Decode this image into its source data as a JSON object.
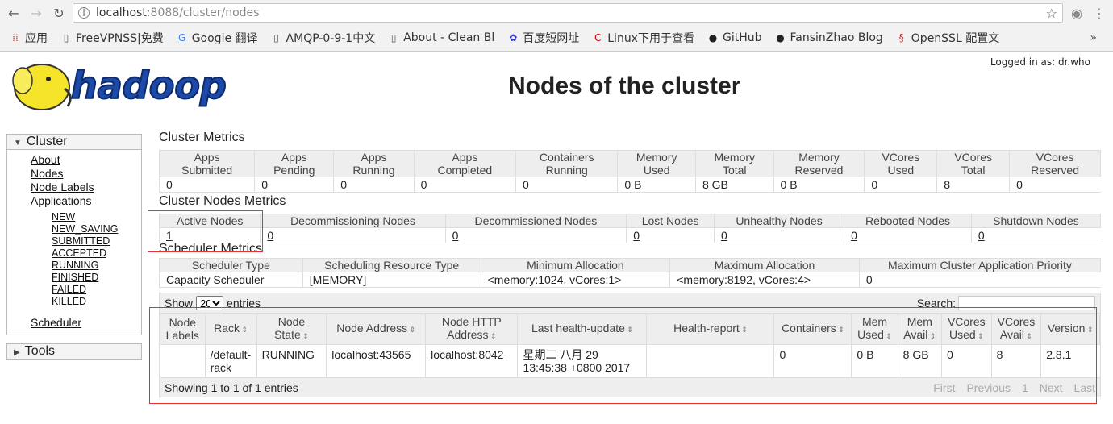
{
  "browser": {
    "url_host": "localhost",
    "url_rest": ":8088/cluster/nodes",
    "bookmarks": [
      {
        "label": "应用",
        "icon": "apps-grid-icon",
        "color": "#d33"
      },
      {
        "label": "FreeVPNSS|免费",
        "icon": "page-icon",
        "color": "#555"
      },
      {
        "label": "Google 翻译",
        "icon": "translate-icon",
        "color": "#4285f4"
      },
      {
        "label": "AMQP-0-9-1中文",
        "icon": "page-icon",
        "color": "#555"
      },
      {
        "label": "About - Clean Bl",
        "icon": "page-icon",
        "color": "#555"
      },
      {
        "label": "百度短网址",
        "icon": "baidu-paw-icon",
        "color": "#2932e1"
      },
      {
        "label": "Linux下用于查看",
        "icon": "c-logo-icon",
        "color": "#c00"
      },
      {
        "label": "GitHub",
        "icon": "github-icon",
        "color": "#222"
      },
      {
        "label": "FansinZhao Blog",
        "icon": "github-icon",
        "color": "#222"
      },
      {
        "label": "OpenSSL 配置文",
        "icon": "openssl-icon",
        "color": "#c22"
      }
    ],
    "more": "»"
  },
  "header": {
    "login": "Logged in as: dr.who",
    "title": "Nodes of the cluster"
  },
  "sidebar": {
    "cluster_label": "Cluster",
    "links": [
      "About",
      "Nodes",
      "Node Labels",
      "Applications"
    ],
    "app_states": [
      "NEW",
      "NEW_SAVING",
      "SUBMITTED",
      "ACCEPTED",
      "RUNNING",
      "FINISHED",
      "FAILED",
      "KILLED"
    ],
    "scheduler": "Scheduler",
    "tools_label": "Tools"
  },
  "cluster_metrics": {
    "title": "Cluster Metrics",
    "headers": [
      [
        "Apps",
        "Submitted"
      ],
      [
        "Apps",
        "Pending"
      ],
      [
        "Apps",
        "Running"
      ],
      [
        "Apps",
        "Completed"
      ],
      [
        "Containers",
        "Running"
      ],
      [
        "Memory",
        "Used"
      ],
      [
        "Memory",
        "Total"
      ],
      [
        "Memory",
        "Reserved"
      ],
      [
        "VCores",
        "Used"
      ],
      [
        "VCores",
        "Total"
      ],
      [
        "VCores",
        "Reserved"
      ]
    ],
    "values": [
      "0",
      "0",
      "0",
      "0",
      "0",
      "0 B",
      "8 GB",
      "0 B",
      "0",
      "8",
      "0"
    ]
  },
  "nodes_metrics": {
    "title": "Cluster Nodes Metrics",
    "headers": [
      "Active Nodes",
      "Decommissioning Nodes",
      "Decommissioned Nodes",
      "Lost Nodes",
      "Unhealthy Nodes",
      "Rebooted Nodes",
      "Shutdown Nodes"
    ],
    "values": [
      "1",
      "0",
      "0",
      "0",
      "0",
      "0",
      "0"
    ]
  },
  "scheduler_metrics": {
    "title": "Scheduler Metrics",
    "headers": [
      "Scheduler Type",
      "Scheduling Resource Type",
      "Minimum Allocation",
      "Maximum Allocation",
      "Maximum Cluster Application Priority"
    ],
    "values": [
      "Capacity Scheduler",
      "[MEMORY]",
      "<memory:1024, vCores:1>",
      "<memory:8192, vCores:4>",
      "0"
    ]
  },
  "nodes_table": {
    "show": "Show",
    "entries": "entries",
    "page_size": "20",
    "search": "Search:",
    "headers": [
      [
        "Node",
        "Labels"
      ],
      [
        "Rack"
      ],
      [
        "Node",
        "State"
      ],
      [
        "Node Address"
      ],
      [
        "Node HTTP",
        "Address"
      ],
      [
        "Last health-update"
      ],
      [
        "Health-report"
      ],
      [
        "Containers"
      ],
      [
        "Mem",
        "Used"
      ],
      [
        "Mem",
        "Avail"
      ],
      [
        "VCores",
        "Used"
      ],
      [
        "VCores",
        "Avail"
      ],
      [
        "Version"
      ]
    ],
    "rows": [
      [
        "",
        "/default-rack",
        "RUNNING",
        "localhost:43565",
        "localhost:8042",
        "星期二 八月 29 13:45:38 +0800 2017",
        "",
        "0",
        "0 B",
        "8 GB",
        "0",
        "8",
        "2.8.1"
      ]
    ],
    "info": "Showing 1 to 1 of 1 entries",
    "pager": [
      "First",
      "Previous",
      "1",
      "Next",
      "Last"
    ]
  }
}
